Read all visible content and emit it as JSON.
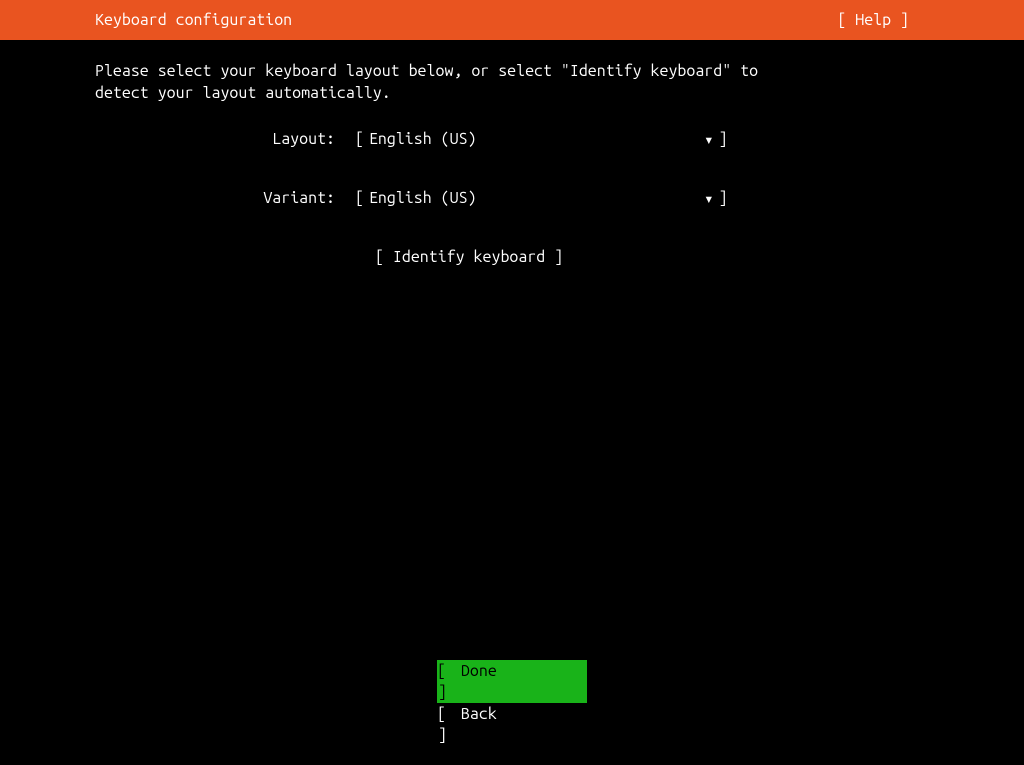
{
  "header": {
    "title": "Keyboard configuration",
    "help": "[ Help ]"
  },
  "instruction": "Please select your keyboard layout below, or select \"Identify keyboard\" to\ndetect your layout automatically.",
  "form": {
    "layout": {
      "label": "Layout:",
      "value": "English (US)",
      "arrow": "▾"
    },
    "variant": {
      "label": "Variant:",
      "value": "English (US)",
      "arrow": "▾"
    }
  },
  "buttons": {
    "identify": "[ Identify keyboard ]",
    "done": "Done",
    "back": "Back",
    "bracket_left": "[",
    "bracket_right": "]"
  }
}
